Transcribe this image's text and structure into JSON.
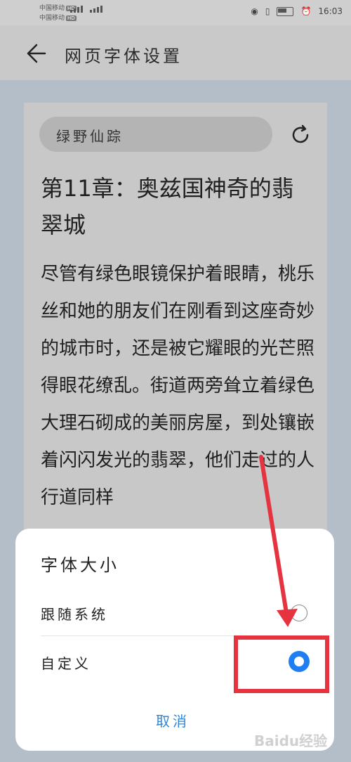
{
  "status_bar": {
    "carrier_1": "中国移动",
    "carrier_1_badge": "HD",
    "carrier_2": "中国移动",
    "carrier_2_badge": "HD",
    "network_1": "4G",
    "network_2": "4G",
    "battery_level": "61",
    "time": "16:03"
  },
  "header": {
    "title": "网页字体设置",
    "back_icon": "back-arrow-icon"
  },
  "preview": {
    "book_tag": "绿野仙踪",
    "chapter_title": "第11章：奥兹国神奇的翡翠城",
    "body_text": "尽管有绿色眼镜保护着眼睛，桃乐丝和她的朋友们在刚看到这座奇妙的城市时，还是被它耀眼的光芒照得眼花缭乱。街道两旁耸立着绿色大理石砌成的美丽房屋，到处镶嵌着闪闪发光的翡翠，他们走过的人行道同样"
  },
  "font_dialog": {
    "title": "字体大小",
    "options": [
      {
        "label": "跟随系统",
        "selected": false
      },
      {
        "label": "自定义",
        "selected": true
      }
    ],
    "cancel_label": "取消"
  },
  "watermark": "Baidu经验",
  "colors": {
    "accent": "#1f7ef2",
    "annotation_red": "#e53340",
    "cancel_text": "#2f86d6"
  }
}
